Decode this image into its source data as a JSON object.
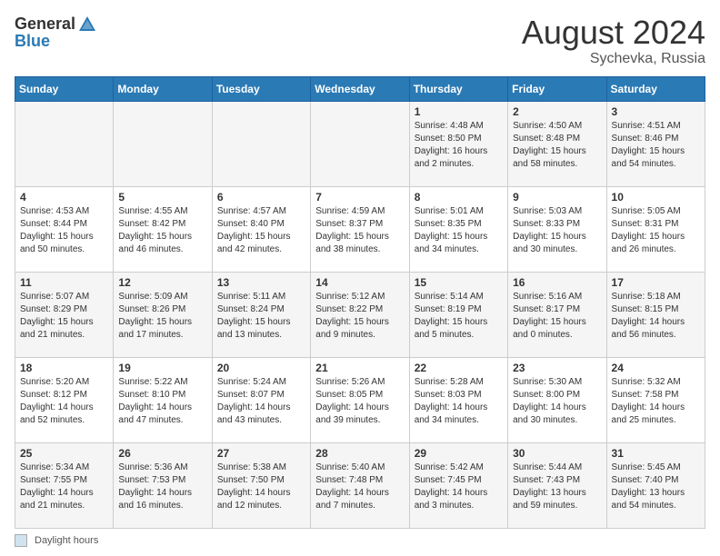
{
  "header": {
    "logo_general": "General",
    "logo_blue": "Blue",
    "month_title": "August 2024",
    "location": "Sychevka, Russia"
  },
  "calendar": {
    "days_of_week": [
      "Sunday",
      "Monday",
      "Tuesday",
      "Wednesday",
      "Thursday",
      "Friday",
      "Saturday"
    ],
    "weeks": [
      [
        {
          "day": "",
          "info": ""
        },
        {
          "day": "",
          "info": ""
        },
        {
          "day": "",
          "info": ""
        },
        {
          "day": "",
          "info": ""
        },
        {
          "day": "1",
          "info": "Sunrise: 4:48 AM\nSunset: 8:50 PM\nDaylight: 16 hours\nand 2 minutes."
        },
        {
          "day": "2",
          "info": "Sunrise: 4:50 AM\nSunset: 8:48 PM\nDaylight: 15 hours\nand 58 minutes."
        },
        {
          "day": "3",
          "info": "Sunrise: 4:51 AM\nSunset: 8:46 PM\nDaylight: 15 hours\nand 54 minutes."
        }
      ],
      [
        {
          "day": "4",
          "info": "Sunrise: 4:53 AM\nSunset: 8:44 PM\nDaylight: 15 hours\nand 50 minutes."
        },
        {
          "day": "5",
          "info": "Sunrise: 4:55 AM\nSunset: 8:42 PM\nDaylight: 15 hours\nand 46 minutes."
        },
        {
          "day": "6",
          "info": "Sunrise: 4:57 AM\nSunset: 8:40 PM\nDaylight: 15 hours\nand 42 minutes."
        },
        {
          "day": "7",
          "info": "Sunrise: 4:59 AM\nSunset: 8:37 PM\nDaylight: 15 hours\nand 38 minutes."
        },
        {
          "day": "8",
          "info": "Sunrise: 5:01 AM\nSunset: 8:35 PM\nDaylight: 15 hours\nand 34 minutes."
        },
        {
          "day": "9",
          "info": "Sunrise: 5:03 AM\nSunset: 8:33 PM\nDaylight: 15 hours\nand 30 minutes."
        },
        {
          "day": "10",
          "info": "Sunrise: 5:05 AM\nSunset: 8:31 PM\nDaylight: 15 hours\nand 26 minutes."
        }
      ],
      [
        {
          "day": "11",
          "info": "Sunrise: 5:07 AM\nSunset: 8:29 PM\nDaylight: 15 hours\nand 21 minutes."
        },
        {
          "day": "12",
          "info": "Sunrise: 5:09 AM\nSunset: 8:26 PM\nDaylight: 15 hours\nand 17 minutes."
        },
        {
          "day": "13",
          "info": "Sunrise: 5:11 AM\nSunset: 8:24 PM\nDaylight: 15 hours\nand 13 minutes."
        },
        {
          "day": "14",
          "info": "Sunrise: 5:12 AM\nSunset: 8:22 PM\nDaylight: 15 hours\nand 9 minutes."
        },
        {
          "day": "15",
          "info": "Sunrise: 5:14 AM\nSunset: 8:19 PM\nDaylight: 15 hours\nand 5 minutes."
        },
        {
          "day": "16",
          "info": "Sunrise: 5:16 AM\nSunset: 8:17 PM\nDaylight: 15 hours\nand 0 minutes."
        },
        {
          "day": "17",
          "info": "Sunrise: 5:18 AM\nSunset: 8:15 PM\nDaylight: 14 hours\nand 56 minutes."
        }
      ],
      [
        {
          "day": "18",
          "info": "Sunrise: 5:20 AM\nSunset: 8:12 PM\nDaylight: 14 hours\nand 52 minutes."
        },
        {
          "day": "19",
          "info": "Sunrise: 5:22 AM\nSunset: 8:10 PM\nDaylight: 14 hours\nand 47 minutes."
        },
        {
          "day": "20",
          "info": "Sunrise: 5:24 AM\nSunset: 8:07 PM\nDaylight: 14 hours\nand 43 minutes."
        },
        {
          "day": "21",
          "info": "Sunrise: 5:26 AM\nSunset: 8:05 PM\nDaylight: 14 hours\nand 39 minutes."
        },
        {
          "day": "22",
          "info": "Sunrise: 5:28 AM\nSunset: 8:03 PM\nDaylight: 14 hours\nand 34 minutes."
        },
        {
          "day": "23",
          "info": "Sunrise: 5:30 AM\nSunset: 8:00 PM\nDaylight: 14 hours\nand 30 minutes."
        },
        {
          "day": "24",
          "info": "Sunrise: 5:32 AM\nSunset: 7:58 PM\nDaylight: 14 hours\nand 25 minutes."
        }
      ],
      [
        {
          "day": "25",
          "info": "Sunrise: 5:34 AM\nSunset: 7:55 PM\nDaylight: 14 hours\nand 21 minutes."
        },
        {
          "day": "26",
          "info": "Sunrise: 5:36 AM\nSunset: 7:53 PM\nDaylight: 14 hours\nand 16 minutes."
        },
        {
          "day": "27",
          "info": "Sunrise: 5:38 AM\nSunset: 7:50 PM\nDaylight: 14 hours\nand 12 minutes."
        },
        {
          "day": "28",
          "info": "Sunrise: 5:40 AM\nSunset: 7:48 PM\nDaylight: 14 hours\nand 7 minutes."
        },
        {
          "day": "29",
          "info": "Sunrise: 5:42 AM\nSunset: 7:45 PM\nDaylight: 14 hours\nand 3 minutes."
        },
        {
          "day": "30",
          "info": "Sunrise: 5:44 AM\nSunset: 7:43 PM\nDaylight: 13 hours\nand 59 minutes."
        },
        {
          "day": "31",
          "info": "Sunrise: 5:45 AM\nSunset: 7:40 PM\nDaylight: 13 hours\nand 54 minutes."
        }
      ]
    ]
  },
  "footer": {
    "daylight_label": "Daylight hours"
  }
}
